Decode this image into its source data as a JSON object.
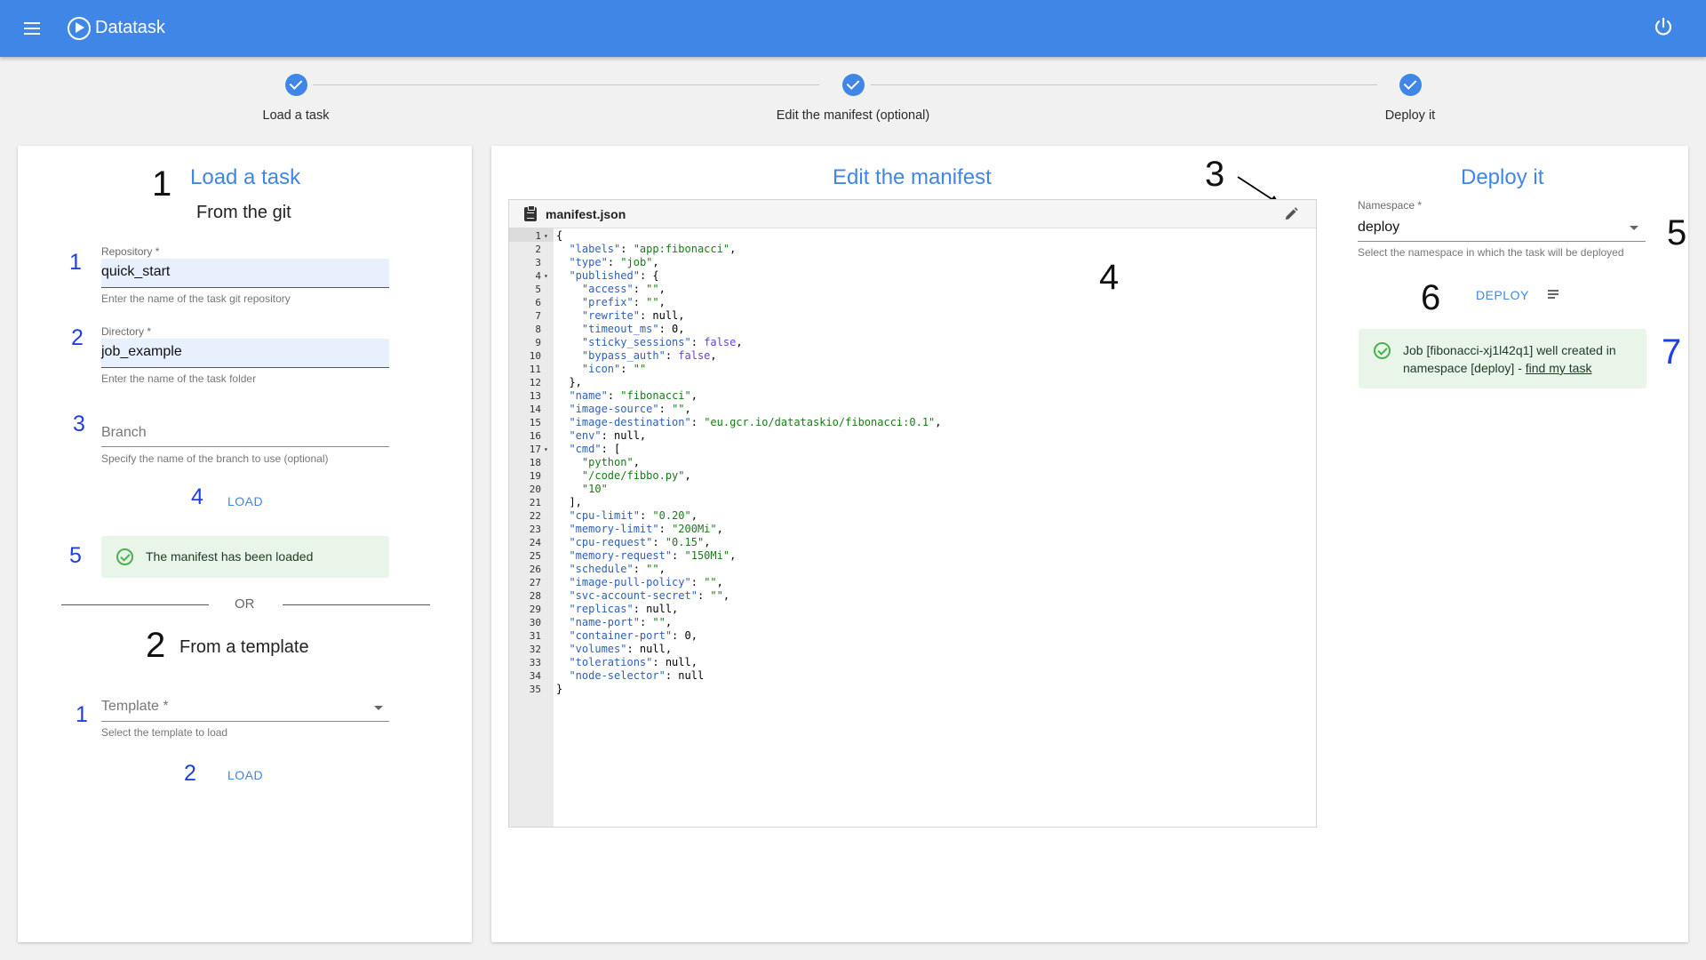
{
  "app": {
    "title": "Datatask",
    "menu_icon": "menu-icon",
    "logo_icon": "play-circle-icon",
    "power_icon": "power-icon",
    "accent": "#3f86e6"
  },
  "stepper": {
    "steps": [
      {
        "label": "Load a task",
        "state": "complete"
      },
      {
        "label": "Edit the manifest (optional)",
        "state": "complete"
      },
      {
        "label": "Deploy it",
        "state": "complete"
      }
    ]
  },
  "load": {
    "number": "1",
    "title": "Load a task",
    "subtitle": "From the git",
    "repository": {
      "num": "1",
      "label": "Repository *",
      "value": "quick_start",
      "hint": "Enter the name of the task git repository"
    },
    "directory": {
      "num": "2",
      "label": "Directory *",
      "value": "job_example",
      "hint": "Enter the name of the task folder"
    },
    "branch": {
      "num": "3",
      "placeholder": "Branch",
      "hint": "Specify the name of the branch to use (optional)"
    },
    "load_num": "4",
    "load_label": "LOAD",
    "alert_num": "5",
    "alert_text": "The manifest has been loaded",
    "or_text": "OR"
  },
  "template": {
    "number": "2",
    "subtitle": "From a template",
    "select": {
      "num": "1",
      "placeholder": "Template *",
      "hint": "Select the template to load"
    },
    "load_num": "2",
    "load_label": "LOAD"
  },
  "manifest": {
    "title": "Edit the manifest",
    "annot_edit": "3",
    "annot_editor": "4",
    "file_name": "manifest.json",
    "lines": [
      {
        "n": "1",
        "fold": true,
        "html": "{"
      },
      {
        "n": "2",
        "html": "  <span class='k'>\"labels\"</span>: <span class='s'>\"app:fibonacci\"</span>,"
      },
      {
        "n": "3",
        "html": "  <span class='k'>\"type\"</span>: <span class='s'>\"job\"</span>,"
      },
      {
        "n": "4",
        "fold": true,
        "html": "  <span class='k'>\"published\"</span>: {"
      },
      {
        "n": "5",
        "html": "    <span class='k'>\"access\"</span>: <span class='s'>\"\"</span>,"
      },
      {
        "n": "6",
        "html": "    <span class='k'>\"prefix\"</span>: <span class='s'>\"\"</span>,"
      },
      {
        "n": "7",
        "html": "    <span class='k'>\"rewrite\"</span>: null,"
      },
      {
        "n": "8",
        "html": "    <span class='k'>\"timeout_ms\"</span>: 0,"
      },
      {
        "n": "9",
        "html": "    <span class='k'>\"sticky_sessions\"</span>: <span class='b'>false</span>,"
      },
      {
        "n": "10",
        "html": "    <span class='k'>\"bypass_auth\"</span>: <span class='b'>false</span>,"
      },
      {
        "n": "11",
        "html": "    <span class='k'>\"icon\"</span>: <span class='s'>\"\"</span>"
      },
      {
        "n": "12",
        "html": "  },"
      },
      {
        "n": "13",
        "html": "  <span class='k'>\"name\"</span>: <span class='s'>\"fibonacci\"</span>,"
      },
      {
        "n": "14",
        "html": "  <span class='k'>\"image-source\"</span>: <span class='s'>\"\"</span>,"
      },
      {
        "n": "15",
        "html": "  <span class='k'>\"image-destination\"</span>: <span class='s'>\"eu.gcr.io/datataskio/fibonacci:0.1\"</span>,"
      },
      {
        "n": "16",
        "html": "  <span class='k'>\"env\"</span>: null,"
      },
      {
        "n": "17",
        "fold": true,
        "html": "  <span class='k'>\"cmd\"</span>: ["
      },
      {
        "n": "18",
        "html": "    <span class='s'>\"python\"</span>,"
      },
      {
        "n": "19",
        "html": "    <span class='s'>\"/code/fibbo.py\"</span>,"
      },
      {
        "n": "20",
        "html": "    <span class='s'>\"10\"</span>"
      },
      {
        "n": "21",
        "html": "  ],"
      },
      {
        "n": "22",
        "html": "  <span class='k'>\"cpu-limit\"</span>: <span class='s'>\"0.20\"</span>,"
      },
      {
        "n": "23",
        "html": "  <span class='k'>\"memory-limit\"</span>: <span class='s'>\"200Mi\"</span>,"
      },
      {
        "n": "24",
        "html": "  <span class='k'>\"cpu-request\"</span>: <span class='s'>\"0.15\"</span>,"
      },
      {
        "n": "25",
        "html": "  <span class='k'>\"memory-request\"</span>: <span class='s'>\"150Mi\"</span>,"
      },
      {
        "n": "26",
        "html": "  <span class='k'>\"schedule\"</span>: <span class='s'>\"\"</span>,"
      },
      {
        "n": "27",
        "html": "  <span class='k'>\"image-pull-policy\"</span>: <span class='s'>\"\"</span>,"
      },
      {
        "n": "28",
        "html": "  <span class='k'>\"svc-account-secret\"</span>: <span class='s'>\"\"</span>,"
      },
      {
        "n": "29",
        "html": "  <span class='k'>\"replicas\"</span>: null,"
      },
      {
        "n": "30",
        "html": "  <span class='k'>\"name-port\"</span>: <span class='s'>\"\"</span>,"
      },
      {
        "n": "31",
        "html": "  <span class='k'>\"container-port\"</span>: 0,"
      },
      {
        "n": "32",
        "html": "  <span class='k'>\"volumes\"</span>: null,"
      },
      {
        "n": "33",
        "html": "  <span class='k'>\"tolerations\"</span>: null,"
      },
      {
        "n": "34",
        "html": "  <span class='k'>\"node-selector\"</span>: null"
      },
      {
        "n": "35",
        "html": "}"
      }
    ]
  },
  "deploy": {
    "title": "Deploy it",
    "namespace_label": "Namespace *",
    "namespace_value": "deploy",
    "namespace_num": "5",
    "namespace_hint": "Select the namespace in which the task will be deployed",
    "deploy_num": "6",
    "deploy_label": "DEPLOY",
    "list_icon": "list-icon",
    "alert_text_1": "Job [fibonacci-xj1l42q1] well created in",
    "alert_text_2": "namespace [deploy] - ",
    "alert_link": "find my task",
    "alert_num": "7"
  }
}
